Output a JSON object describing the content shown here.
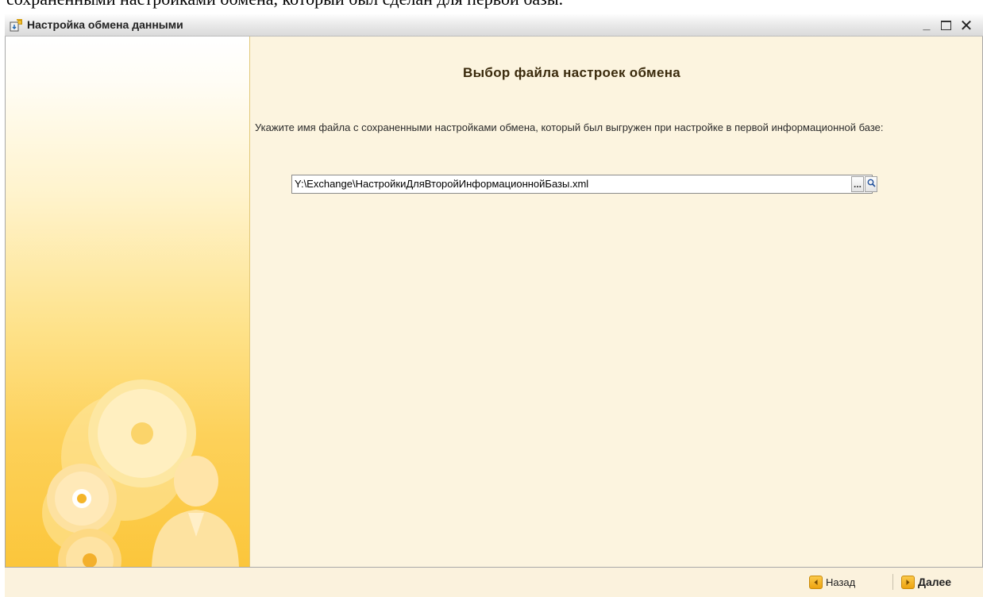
{
  "document": {
    "background_text": "сохраненными настройками обмена, который был сделан для первой базы."
  },
  "window": {
    "title": "Настройка обмена данными",
    "icon": "exchange-settings-icon",
    "controls": {
      "minimize": "_",
      "maximize": "□",
      "close": "✕"
    }
  },
  "main": {
    "title": "Выбор файла настроек обмена",
    "instruction": "Укажите имя файла с сохраненными настройками обмена, который был выгружен при настройке в первой информационной базе:",
    "file_field": {
      "value": "Y:\\Exchange\\НастройкиДляВторойИнформационнойБазы.xml",
      "browse_label": "...",
      "open_icon": "magnifier-icon"
    }
  },
  "footer": {
    "back_label": "Назад",
    "next_label": "Далее"
  },
  "colors": {
    "accent": "#f5b31f",
    "background": "#fcf4df",
    "title_text": "#3a2a0c"
  }
}
